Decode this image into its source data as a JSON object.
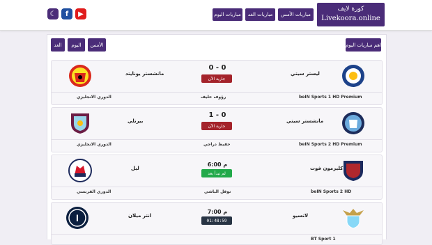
{
  "header": {
    "logo_line1": "كورة لايف",
    "logo_line2": "Livekoora.online",
    "nav": [
      "مباريات الأمس",
      "مباريات الغد",
      "مباريات اليوم"
    ]
  },
  "social": {
    "moon": "☾",
    "facebook": "f",
    "youtube": "▶"
  },
  "tabs": {
    "today_matches": "اهم مباريات اليوم",
    "yesterday": "الأمس",
    "today": "اليوم",
    "tomorrow": "الغد"
  },
  "matches": [
    {
      "home": "ليستر سيتي",
      "away": "مانشستر يونايتد",
      "score": "0 - 0",
      "status": "جارية الآن",
      "channel": "beIN Sports 1 HD Premium",
      "commentator": "رؤوف خليف",
      "league": "الدوري الانجليزي"
    },
    {
      "home": "مانشستر سيتي",
      "away": "بيرنلي",
      "score": "1 - 0",
      "status": "جارية الآن",
      "channel": "beIN Sports 2 HD Premium",
      "commentator": "حفيظ دراجي",
      "league": "الدوري الانجليزي"
    },
    {
      "home": "كليرمون فوت",
      "away": "ليل",
      "time": "6:00 م",
      "status": "لم تبدأ بعد",
      "channel": "beIN Sports 2 HD",
      "commentator": "نوفل الباشي",
      "league": "الدوري الفرنسي"
    },
    {
      "home": "لاتسيو",
      "away": "انتر ميلان",
      "time": "7:00 م",
      "status": "01:48:59",
      "channel": "BT Sport 1",
      "commentator": "",
      "league": ""
    }
  ],
  "colors": {
    "brand": "#4a2c78",
    "live": "#a4232b",
    "upcoming": "#22a94a",
    "countdown": "#283444"
  }
}
